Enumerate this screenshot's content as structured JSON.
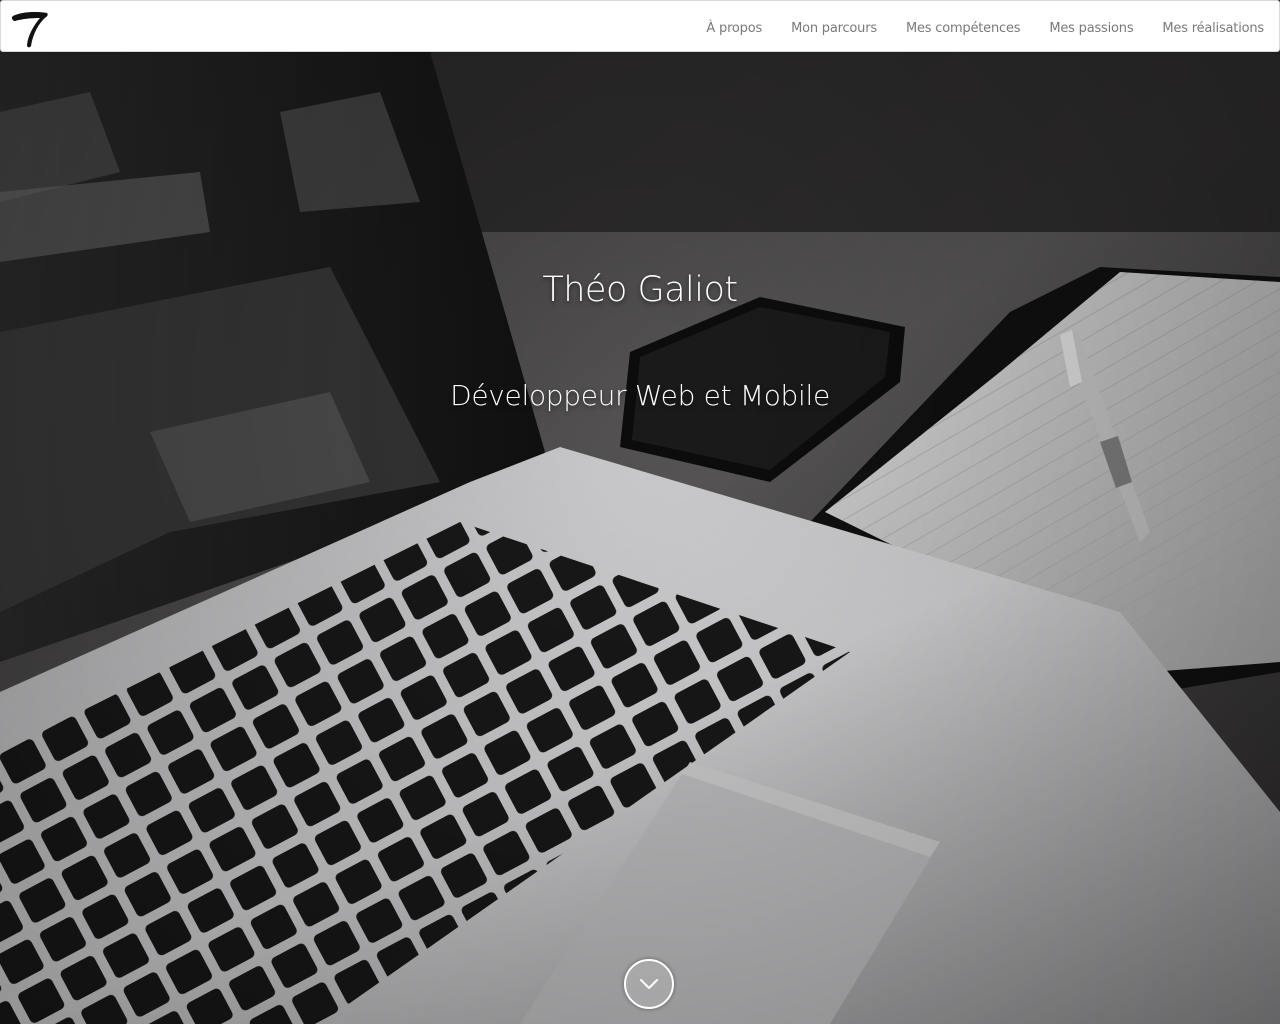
{
  "navbar": {
    "logo_icon": "seven-brush-logo",
    "links": [
      {
        "label": "À propos"
      },
      {
        "label": "Mon parcours"
      },
      {
        "label": "Mes compétences"
      },
      {
        "label": "Mes passions"
      },
      {
        "label": "Mes réalisations"
      }
    ]
  },
  "hero": {
    "title": "Théo Galiot",
    "subtitle": "Développeur Web et Mobile",
    "background": "laptop-phone-notebook-pen-photo",
    "scroll_icon": "chevron-down-icon"
  },
  "colors": {
    "nav_background": "#ffffff",
    "nav_text": "#7a7a7a",
    "hero_text": "#ffffff"
  }
}
